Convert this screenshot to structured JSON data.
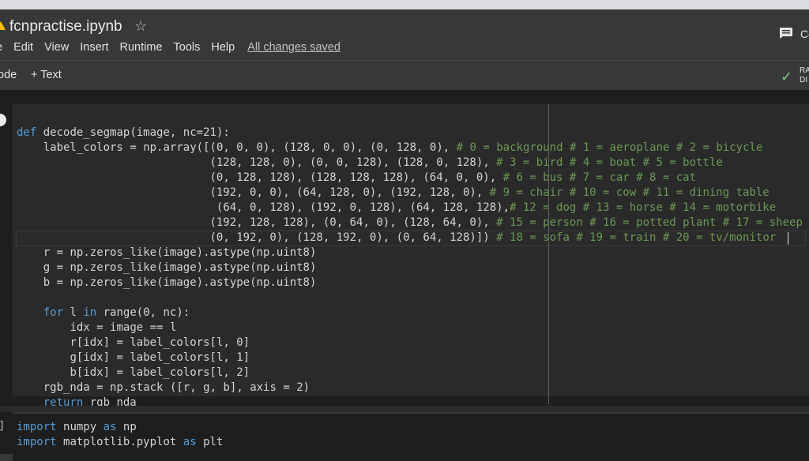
{
  "header": {
    "title": "fcnpractise.ipynb",
    "menu": [
      "e",
      "Edit",
      "View",
      "Insert",
      "Runtime",
      "Tools",
      "Help"
    ],
    "saved": "All changes saved",
    "comment_label": "Co"
  },
  "toolbar": {
    "code_label": "ode",
    "text_label": "+ Text",
    "ram_line1": "RA",
    "ram_line2": "DI"
  },
  "cell1": {
    "lines": [
      {
        "code": "def decode_segmap(image, nc=21):",
        "comment": ""
      },
      {
        "code": "    label_colors = np.array([(0, 0, 0), (128, 0, 0), (0, 128, 0), ",
        "comment": "# 0 = background # 1 = aeroplane # 2 = bicycle"
      },
      {
        "code": "                             (128, 128, 0), (0, 0, 128), (128, 0, 128), ",
        "comment": "# 3 = bird # 4 = boat # 5 = bottle"
      },
      {
        "code": "                             (0, 128, 128), (128, 128, 128), (64, 0, 0), ",
        "comment": "# 6 = bus # 7 = car # 8 = cat"
      },
      {
        "code": "                             (192, 0, 0), (64, 128, 0), (192, 128, 0), ",
        "comment": "# 9 = chair # 10 = cow # 11 = dining table"
      },
      {
        "code": "                              (64, 0, 128), (192, 0, 128), (64, 128, 128),",
        "comment": "# 12 = dog # 13 = horse # 14 = motorbike"
      },
      {
        "code": "                             (192, 128, 128), (0, 64, 0), (128, 64, 0), ",
        "comment": "# 15 = person # 16 = potted plant # 17 = sheep"
      },
      {
        "code": "                             (0, 192, 0), (128, 192, 0), (0, 64, 128)]) ",
        "comment": "# 18 = sofa # 19 = train # 20 = tv/monitor"
      },
      {
        "code": "    r = np.zeros_like(image).astype(np.uint8)",
        "comment": ""
      },
      {
        "code": "    g = np.zeros_like(image).astype(np.uint8)",
        "comment": ""
      },
      {
        "code": "    b = np.zeros_like(image).astype(np.uint8)",
        "comment": ""
      },
      {
        "code": "",
        "comment": ""
      },
      {
        "code": "    for l in range(0, nc):",
        "comment": ""
      },
      {
        "code": "        idx = image == l",
        "comment": ""
      },
      {
        "code": "        r[idx] = label_colors[l, 0]",
        "comment": ""
      },
      {
        "code": "        g[idx] = label_colors[l, 1]",
        "comment": ""
      },
      {
        "code": "        b[idx] = label_colors[l, 2]",
        "comment": ""
      },
      {
        "code": "    rgb_nda = np.stack ([r, g, b], axis = 2)",
        "comment": ""
      },
      {
        "code": "    return rgb_nda",
        "comment": ""
      }
    ]
  },
  "cell2": {
    "bracket": "]",
    "lines": [
      {
        "code": "import numpy as np",
        "comment": ""
      },
      {
        "code": "import matplotlib.pyplot as plt",
        "comment": ""
      }
    ]
  },
  "keywords": [
    "def",
    "for",
    "in",
    "return",
    "import",
    "as"
  ],
  "colors": {
    "keyword": "#569cd6",
    "comment": "#6a9955",
    "code_text": "#d4d4d4",
    "editor_bg": "#2a2a2a"
  }
}
